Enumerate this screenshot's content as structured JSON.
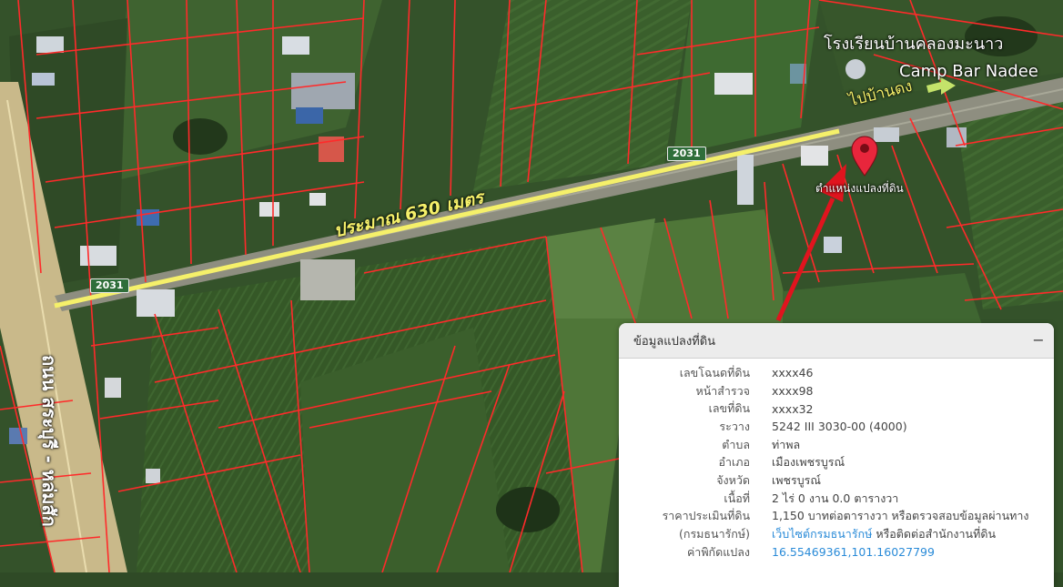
{
  "map": {
    "school_label": "โรงเรียนบ้านคลองมะนาว",
    "bar_label": "Camp Bar Nadee",
    "direction_label": "ไปบ้านดง",
    "distance_label": "ประมาณ 630 เมตร",
    "pin_label": "ตำแหน่งแปลงที่ดิน",
    "highway_label": "ถนน สระบุรี - หล่มสัก",
    "road_shields": [
      "2031",
      "2031"
    ],
    "colors": {
      "highlight": "#f5f06a",
      "arrow": "#e0141e",
      "parcel": "#ff2a2a",
      "pin": "#e8263c"
    },
    "icons": {
      "pin": "location-pin-icon",
      "arrow": "right-arrow-icon"
    }
  },
  "panel": {
    "title": "ข้อมูลแปลงที่ดิน",
    "collapse": "−",
    "rows": [
      {
        "label": "เลขโฉนดที่ดิน",
        "value": "xxxx46"
      },
      {
        "label": "หน้าสำรวจ",
        "value": "xxxx98"
      },
      {
        "label": "เลขที่ดิน",
        "value": "xxxx32"
      },
      {
        "label": "ระวาง",
        "value": "5242 III 3030-00 (4000)"
      },
      {
        "label": "ตำบล",
        "value": "ท่าพล"
      },
      {
        "label": "อำเภอ",
        "value": "เมืองเพชรบูรณ์"
      },
      {
        "label": "จังหวัด",
        "value": "เพชรบูรณ์"
      },
      {
        "label": "เนื้อที่",
        "value": "2 ไร่ 0 งาน 0.0 ตารางวา"
      },
      {
        "label": "ราคาประเมินที่ดิน",
        "value": "1,150 บาทต่อตารางวา หรือตรวจสอบข้อมูลผ่านทาง"
      },
      {
        "label": "(กรมธนารักษ์)",
        "link": "เว็บไซต์กรมธนารักษ์",
        "value": " หรือติดต่อสำนักงานที่ดิน"
      },
      {
        "label": "ค่าพิกัดแปลง",
        "value": "16.55469361,101.16027799"
      }
    ]
  }
}
